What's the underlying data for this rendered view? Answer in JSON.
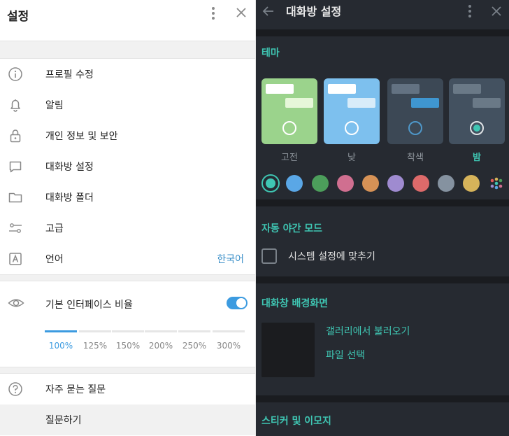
{
  "left": {
    "title": "설정",
    "menu": [
      {
        "id": "profile",
        "label": "프로필 수정",
        "icon": "info-icon"
      },
      {
        "id": "notifications",
        "label": "알림",
        "icon": "bell-icon"
      },
      {
        "id": "privacy",
        "label": "개인 정보 및 보안",
        "icon": "lock-icon"
      },
      {
        "id": "chat-settings",
        "label": "대화방 설정",
        "icon": "chat-bubble-icon"
      },
      {
        "id": "chat-folders",
        "label": "대화방 폴더",
        "icon": "folder-icon"
      },
      {
        "id": "advanced",
        "label": "고급",
        "icon": "sliders-icon"
      },
      {
        "id": "language",
        "label": "언어",
        "icon": "language-icon",
        "value": "한국어"
      }
    ],
    "scale": {
      "label": "기본 인터페이스 비율",
      "enabled": true,
      "options": [
        "100%",
        "125%",
        "150%",
        "200%",
        "250%",
        "300%"
      ],
      "selected": "100%"
    },
    "help": [
      {
        "id": "faq",
        "label": "자주 묻는 질문",
        "icon": "question-icon"
      },
      {
        "id": "ask",
        "label": "질문하기"
      }
    ]
  },
  "right": {
    "title": "대화방 설정",
    "theme": {
      "title": "테마",
      "options": [
        {
          "label": "고전",
          "bg": "#9bd38c",
          "bub1": "#ffffff",
          "bub2": "#e6f7d9",
          "selected": false
        },
        {
          "label": "낮",
          "bg": "#7dc0ee",
          "bub1": "#ffffff",
          "bub2": "#d8ecf9",
          "selected": false
        },
        {
          "label": "착색",
          "bg": "#3c4855",
          "bub1": "#637282",
          "bub2": "#3f96d0",
          "selected": false
        },
        {
          "label": "밤",
          "bg": "#435160",
          "bub1": "#6a7987",
          "bub2": "#6a7987",
          "selected": true
        }
      ],
      "accents": [
        "#3fc6b3",
        "#5aa7e6",
        "#4c9e5b",
        "#d06f90",
        "#d69256",
        "#9f8bd0",
        "#dd6a6a",
        "#8592a0",
        "#d6b35a",
        "multi"
      ]
    },
    "night_mode": {
      "title": "자동 야간 모드",
      "checkbox_label": "시스템 설정에 맞추기",
      "checked": false
    },
    "background": {
      "title": "대화창 배경화면",
      "gallery": "갤러리에서 불러오기",
      "file": "파일 선택"
    },
    "stickers": {
      "title": "스티커 및 이모지"
    }
  }
}
